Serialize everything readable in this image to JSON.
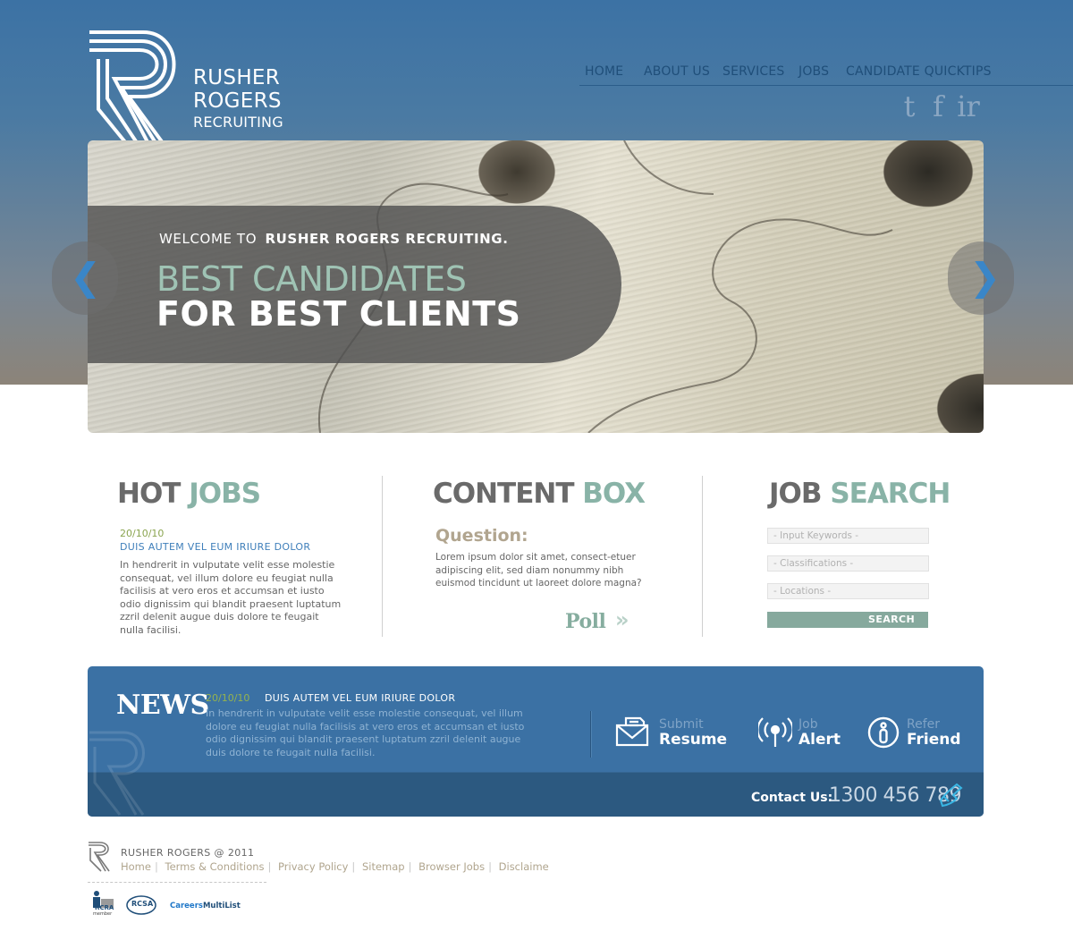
{
  "logo": {
    "line1": "RUSHER",
    "line2": "ROGERS",
    "line3": "RECRUITING"
  },
  "nav": {
    "items": [
      "HOME",
      "ABOUT US",
      "SERVICES",
      "JOBS",
      "CANDIDATE QUICKTIPS"
    ]
  },
  "social": {
    "twitter": "t",
    "facebook": "f",
    "other": "ir"
  },
  "hero": {
    "welcome": "WELCOME TO",
    "welcome_bold": "RUSHER ROGERS RECRUITING.",
    "headline1": "BEST CANDIDATES",
    "headline2": "FOR BEST CLIENTS",
    "prev": "❮",
    "next": "❯"
  },
  "hot_jobs": {
    "title_dark": "HOT",
    "title_teal": "JOBS",
    "date": "20/10/10",
    "headline": "DUIS AUTEM VEL EUM IRIURE DOLOR",
    "body": "In hendrerit in vulputate velit esse molestie consequat, vel illum dolore eu feugiat nulla facilisis at vero eros et accumsan et iusto odio dignissim qui blandit praesent luptatum zzril delenit augue duis dolore te feugait nulla facilisi."
  },
  "content_box": {
    "title_dark": "CONTENT",
    "title_teal": "BOX",
    "question": "Question:",
    "body": "Lorem ipsum dolor sit amet, consect-etuer adipiscing elit, sed diam nonummy nibh euismod tincidunt ut laoreet dolore magna?",
    "poll": "Poll",
    "poll_arrow": "»"
  },
  "job_search": {
    "title_dark": "JOB",
    "title_teal": "SEARCH",
    "keywords": "- Input Keywords -",
    "classifications": "- Classifications -",
    "locations": "- Locations -",
    "button": "SEARCH"
  },
  "news": {
    "title": "NEWS",
    "date": "20/10/10",
    "headline": "DUIS AUTEM VEL EUM IRIURE DOLOR",
    "body": "In hendrerit in vulputate velit esse molestie consequat, vel illum dolore eu feugiat nulla facilisis at vero eros et accumsan et iusto odio dignissim qui blandit praesent luptatum zzril delenit augue duis dolore te feugait nulla facilisi.",
    "actions": [
      {
        "small": "Submit",
        "big": "Resume",
        "icon": "envelope-icon"
      },
      {
        "small": "Job",
        "big": "Alert",
        "icon": "signal-icon"
      },
      {
        "small": "Refer",
        "big": "Friend",
        "icon": "info-icon"
      }
    ],
    "contact_label": "Contact Us:",
    "contact_number": "1300 456 789"
  },
  "footer": {
    "copyright": "RUSHER ROGERS @ 2011",
    "links": [
      "Home",
      "Terms & Conditions",
      "Privacy Policy",
      "Sitemap",
      "Browser Jobs",
      "Disclaime"
    ],
    "badges": {
      "rcra": "RCRA",
      "rcra_sub": "member",
      "rcsa": "RCSA",
      "careers": "Careers",
      "multilist": "MultiList"
    }
  },
  "colors": {
    "blue": "#3c72a4",
    "teal": "#89b3a7",
    "green": "#8aa44f",
    "gray": "#6a6a6a"
  }
}
